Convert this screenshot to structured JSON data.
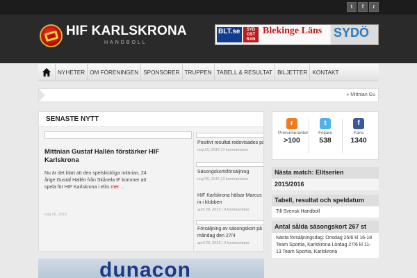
{
  "topbar": {
    "icons": [
      "twitter-icon",
      "facebook-icon",
      "rss-icon"
    ],
    "twitter_glyph": "t",
    "facebook_glyph": "f",
    "rss_glyph": "r"
  },
  "header": {
    "title": "HIF KARLSKRONA",
    "subtitle": "HANDBOLL"
  },
  "banner": {
    "blt": "BLT.se",
    "sydost": "SYD OST RAN",
    "blekinge": "Blekinge Läns",
    "sydo": "SYDÖ"
  },
  "nav": {
    "items": [
      "NYHETER",
      "OM FÖRENINGEN",
      "SPONSORER",
      "TRUPPEN",
      "TABELL & RESULTAT",
      "BILJETTER",
      "KONTAKT"
    ]
  },
  "ticker": {
    "text": "» Mittnian Gu"
  },
  "news": {
    "heading": "SENASTE NYTT",
    "feature": {
      "title": "Mittnian Gustaf Hallén förstärker HIF Karlskrona",
      "body": "Nu är det klart att den spelskickliga mittnian, 24 årige Gustaf Hallén från Skånela IF kommer att spela för HIF Karlskrona i elits",
      "more": "mer",
      "ellipsis": " …",
      "date": "maj 26, 2015"
    },
    "items": [
      {
        "title": "Positivt resultat redovisades på årsmötet",
        "meta": "maj 25, 2015 | 0 kommentarer"
      },
      {
        "title": "Säsongskortsförsäljning",
        "meta": "maj 05, 2015 | 0 kommentarer"
      },
      {
        "title": "HIF Karlskrona hälsar Marcus Gadd välkommen in i klubben",
        "meta": "april 29, 2015 | 0 kommentarer"
      },
      {
        "title": "Försäljning av säsongskort på Team Sportia måndag den 27/4",
        "meta": "april 26, 2015 | 0 kommentarer"
      }
    ]
  },
  "ad": {
    "text": "dunacon"
  },
  "stats": [
    {
      "icon": "rss-icon",
      "glyph": "r",
      "color": "#f07c1e",
      "label": "Prenumeranter",
      "value": ">100"
    },
    {
      "icon": "twitter-icon",
      "glyph": "t",
      "color": "#4fb2e8",
      "label": "Följare",
      "value": "538"
    },
    {
      "icon": "facebook-icon",
      "glyph": "f",
      "color": "#3b5998",
      "label": "Fans",
      "value": "1340"
    }
  ],
  "widgets": {
    "next_match": {
      "title": "Nästa match: Elitserien",
      "value": "2015/2016"
    },
    "table": {
      "title": "Tabell, resultat och speldatum",
      "link": "Till Svensk Handboll"
    },
    "cards": {
      "title": "Antal sålda säsongskort 267 st",
      "body": "Nästa försäljningsdag: Onsdag 25/6 kl 16-18 Team Sportia, Karlskrona Lördag 27/6 kl 11-13 Team Sportia, Karlskrona"
    }
  }
}
